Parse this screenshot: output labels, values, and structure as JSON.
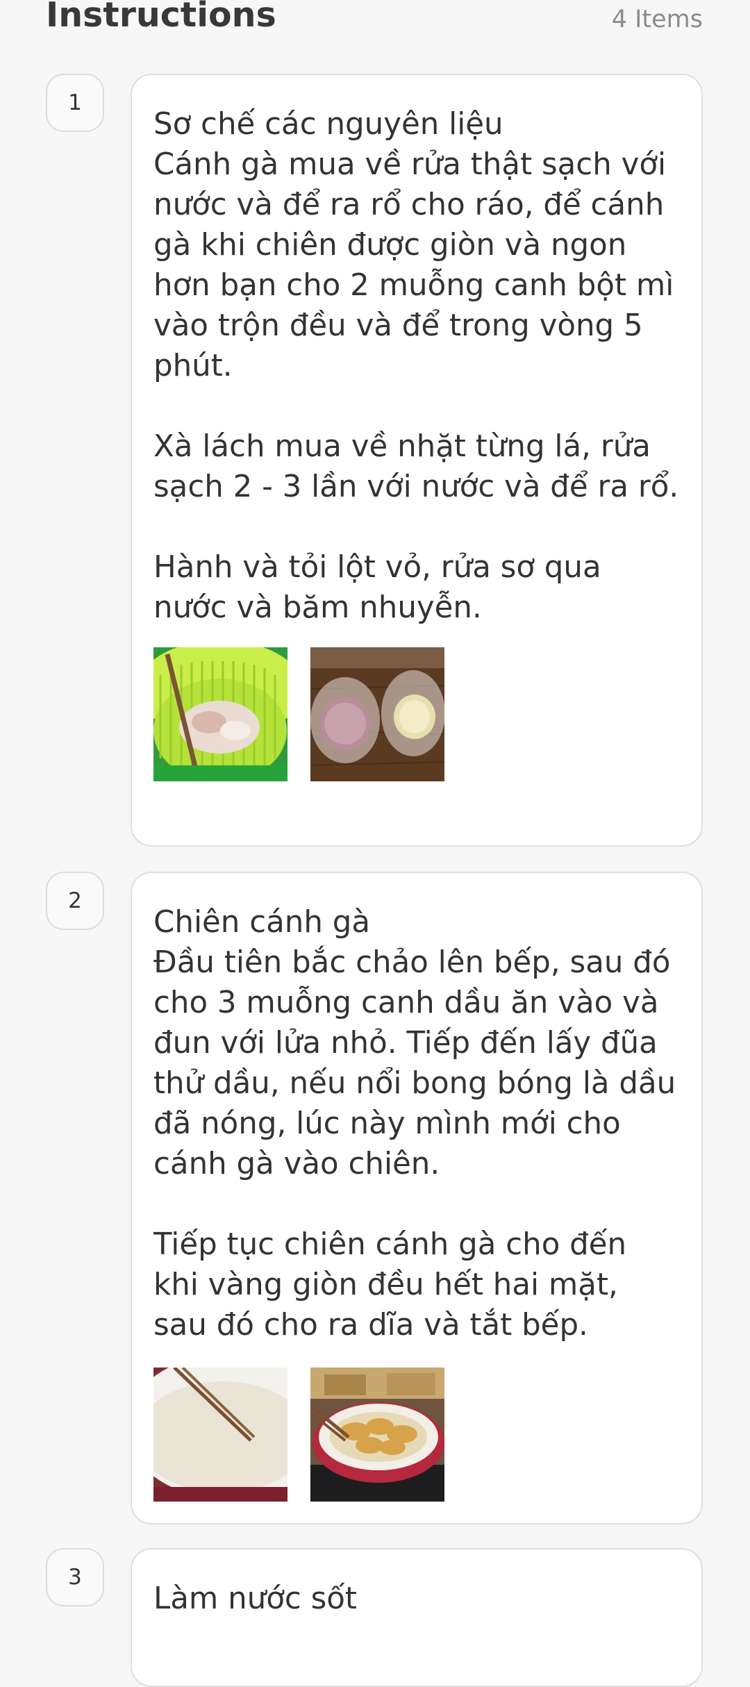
{
  "header": {
    "title": "Instructions",
    "count": "4 Items"
  },
  "steps": [
    {
      "number": "1",
      "text": "Sơ chế các nguyên liệu\nCánh gà mua về rửa thật sạch với nước và để ra rổ cho ráo, để cánh gà khi chiên được giòn và ngon hơn bạn cho 2 muỗng canh bột mì vào trộn đều và để trong vòng 5 phút.\n\nXà lách mua về nhặt từng lá, rửa sạch 2 - 3 lần với nước và để ra rổ.\n\nHành và tỏi lột vỏ, rửa sơ qua nước và băm nhuyễn.",
      "images": [
        "chicken-wings-in-green-colander-photo",
        "minced-shallots-and-garlic-bowls-photo"
      ]
    },
    {
      "number": "2",
      "text": "Chiên cánh gà\nĐầu tiên bắc chảo lên bếp, sau đó cho 3 muỗng canh dầu ăn vào và đun với lửa nhỏ. Tiếp đến lấy đũa thử dầu, nếu nổi bong bóng là dầu đã nóng, lúc này mình mới cho cánh gà vào chiên.\n\nTiếp tục chiên cánh gà cho đến khi vàng giòn đều hết hai mặt, sau đó cho ra dĩa và tắt bếp.",
      "images": [
        "batter-bowl-with-chopsticks-photo",
        "fried-chicken-wings-in-pan-photo"
      ]
    },
    {
      "number": "3",
      "text": "Làm nước sốt",
      "images": []
    }
  ]
}
